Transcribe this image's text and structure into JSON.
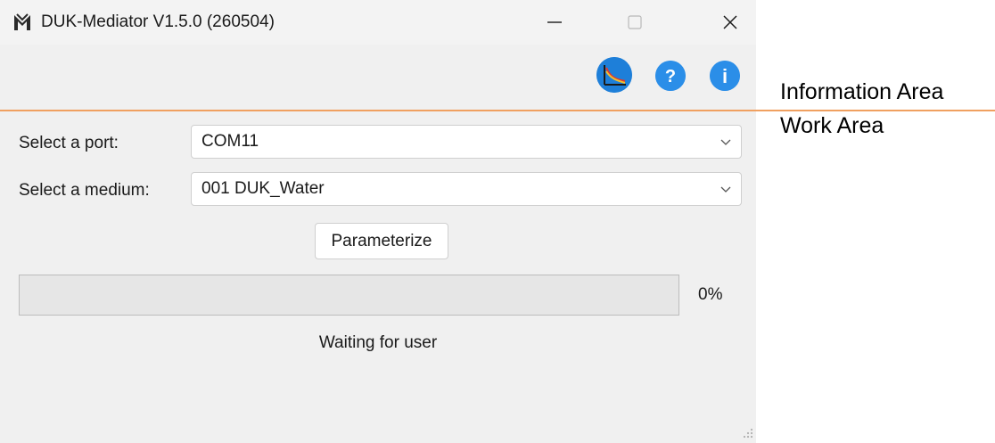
{
  "window": {
    "title": "DUK-Mediator V1.5.0 (260504)",
    "controls": {
      "minimize": "minimize-icon",
      "maximize": "maximize-icon",
      "close": "close-icon"
    }
  },
  "toolbar": {
    "icons": [
      "chart-icon",
      "help-icon",
      "info-icon"
    ],
    "help_glyph": "?",
    "info_glyph": "i"
  },
  "annotations": {
    "information_area": "Information Area",
    "work_area": "Work Area"
  },
  "form": {
    "port_label": "Select a port:",
    "port_value": "COM11",
    "medium_label": "Select a medium:",
    "medium_value": "001 DUK_Water",
    "parameterize_label": "Parameterize"
  },
  "progress": {
    "value": 0,
    "percent_text": "0%",
    "status_text": "Waiting for user"
  },
  "colors": {
    "accent_blue": "#2b8ee8",
    "divider_orange": "#f0a060",
    "window_bg": "#f0f0f0"
  }
}
